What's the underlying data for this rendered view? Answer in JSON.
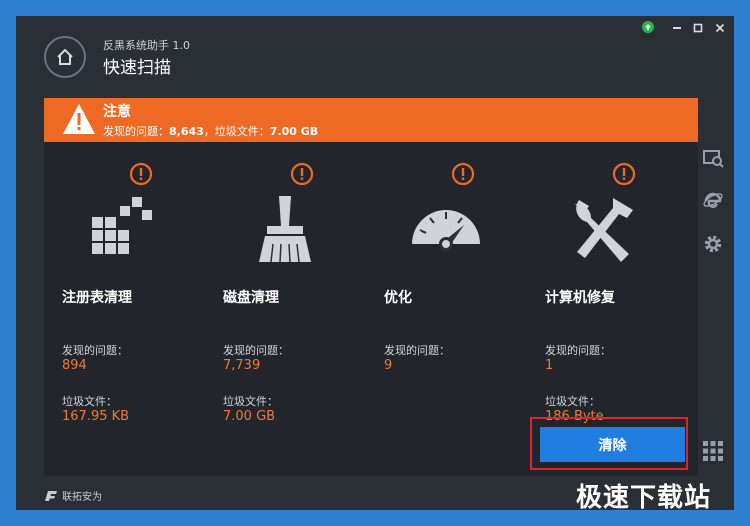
{
  "app": {
    "name": "反黑系统助手 1.0",
    "title": "快速扫描"
  },
  "alert": {
    "title": "注意",
    "label_issues": "发现的问题：",
    "issues_value": "8,643",
    "label_junk": "，垃圾文件：",
    "junk_value": "7.00 GB"
  },
  "cards": [
    {
      "title": "注册表清理",
      "issues_label": "发现的问题：",
      "issues": "894",
      "junk_label": "垃圾文件：",
      "junk": "167.95 KB"
    },
    {
      "title": "磁盘清理",
      "issues_label": "发现的问题：",
      "issues": "7,739",
      "junk_label": "垃圾文件：",
      "junk": "7.00 GB"
    },
    {
      "title": "优化",
      "issues_label": "发现的问题：",
      "issues": "9"
    },
    {
      "title": "计算机修复",
      "issues_label": "发现的问题：",
      "issues": "1",
      "junk_label": "垃圾文件：",
      "junk": "186 Byte"
    }
  ],
  "clean_button": "清除",
  "brand": "联拓安为",
  "watermark": "极速下载站",
  "colors": {
    "accent": "#ee6a24",
    "button": "#1f7ee0",
    "highlight": "#d9262b"
  }
}
